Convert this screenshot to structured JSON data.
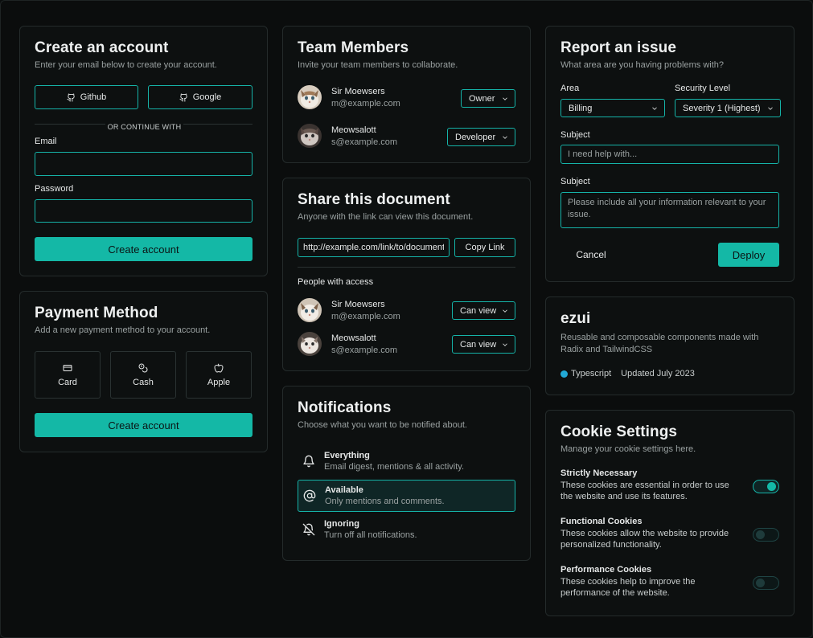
{
  "colors": {
    "accent": "#14b8a6",
    "background": "#0b0d0d",
    "card": "#0d1010",
    "border": "#242b2b",
    "muted": "#9aa1a1"
  },
  "create_account": {
    "title": "Create an account",
    "subtitle": "Enter your email below to create your account.",
    "github_label": "Github",
    "google_label": "Google",
    "divider_text": "OR CONTINUE WITH",
    "email_label": "Email",
    "email_value": "",
    "password_label": "Password",
    "password_value": "",
    "submit_label": "Create account"
  },
  "payment": {
    "title": "Payment Method",
    "subtitle": "Add a new payment method to your account.",
    "options": [
      {
        "label": "Card",
        "icon": "card-icon"
      },
      {
        "label": "Cash",
        "icon": "cash-icon"
      },
      {
        "label": "Apple",
        "icon": "apple-icon"
      }
    ],
    "submit_label": "Create account"
  },
  "team": {
    "title": "Team Members",
    "subtitle": "Invite your team members to collaborate.",
    "members": [
      {
        "name": "Sir Moewsers",
        "email": "m@example.com",
        "role": "Owner"
      },
      {
        "name": "Meowsalott",
        "email": "s@example.com",
        "role": "Developer"
      }
    ]
  },
  "share": {
    "title": "Share this document",
    "subtitle": "Anyone with the link can view this document.",
    "link_value": "http://example.com/link/to/document",
    "copy_label": "Copy Link",
    "people_heading": "People with access",
    "people": [
      {
        "name": "Sir Moewsers",
        "email": "m@example.com",
        "permission": "Can view"
      },
      {
        "name": "Meowsalott",
        "email": "s@example.com",
        "permission": "Can view"
      }
    ]
  },
  "notifications": {
    "title": "Notifications",
    "subtitle": "Choose what you want to be notified about.",
    "items": [
      {
        "title": "Everything",
        "desc": "Email digest, mentions & all activity.",
        "icon": "bell-icon",
        "selected": false
      },
      {
        "title": "Available",
        "desc": "Only mentions and comments.",
        "icon": "at-sign-icon",
        "selected": true
      },
      {
        "title": "Ignoring",
        "desc": "Turn off all notifications.",
        "icon": "bell-off-icon",
        "selected": false
      }
    ]
  },
  "report": {
    "title": "Report an issue",
    "subtitle": "What area are you having problems with?",
    "area_label": "Area",
    "area_value": "Billing",
    "security_label": "Security Level",
    "security_value": "Severity 1 (Highest)",
    "subject_label": "Subject",
    "subject_placeholder": "I need help with...",
    "description_label": "Subject",
    "description_placeholder": "Please include all your information relevant to your issue.",
    "cancel_label": "Cancel",
    "deploy_label": "Deploy"
  },
  "repo": {
    "title": "ezui",
    "description": "Reusable and composable components made with Radix and TailwindCSS",
    "language": "Typescript",
    "language_color": "#22a9d6",
    "updated": "Updated July 2023"
  },
  "cookies": {
    "title": "Cookie Settings",
    "subtitle": "Manage your cookie settings here.",
    "items": [
      {
        "title": "Strictly Necessary",
        "desc": "These cookies are essential in order to use the website and use its features.",
        "enabled": true
      },
      {
        "title": "Functional Cookies",
        "desc": "These cookies allow the website to provide personalized functionality.",
        "enabled": false
      },
      {
        "title": "Performance Cookies",
        "desc": "These cookies help to improve the performance of the website.",
        "enabled": false
      }
    ]
  }
}
